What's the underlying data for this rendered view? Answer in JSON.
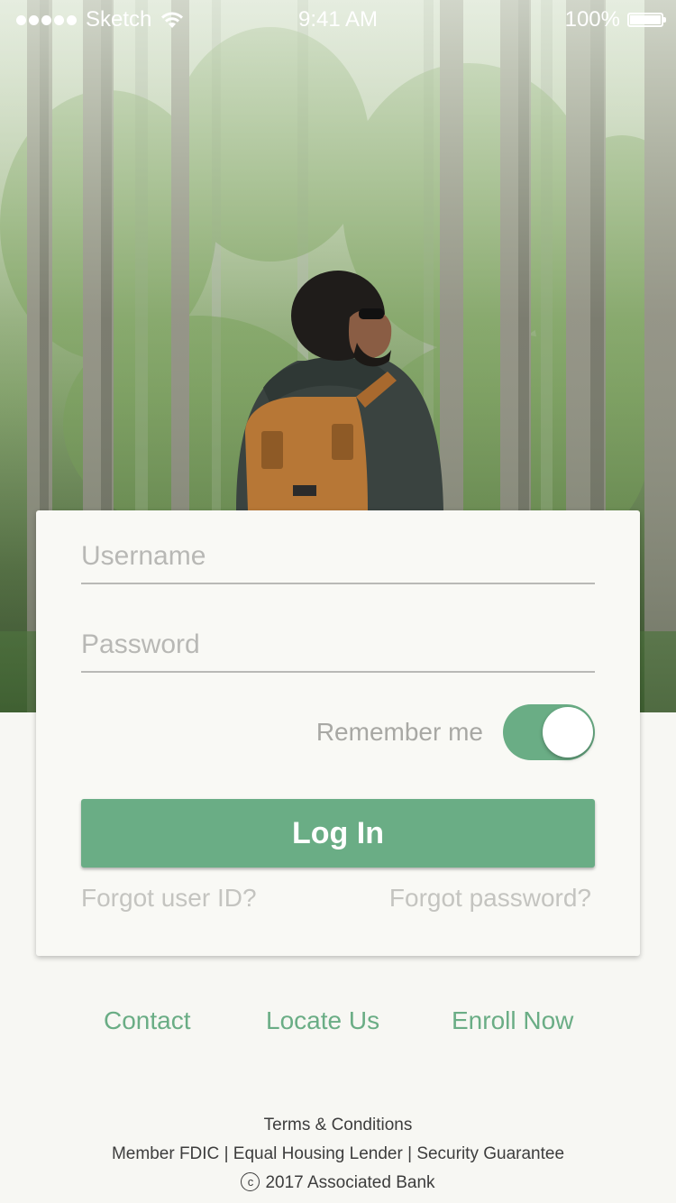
{
  "status_bar": {
    "carrier": "Sketch",
    "time": "9:41 AM",
    "battery_percent": "100%",
    "battery_level": 1.0
  },
  "login": {
    "username_placeholder": "Username",
    "password_placeholder": "Password",
    "remember_label": "Remember me",
    "remember_on": true,
    "login_button": "Log In",
    "forgot_user": "Forgot user ID?",
    "forgot_password": "Forgot password?"
  },
  "nav": {
    "contact": "Contact",
    "locate": "Locate Us",
    "enroll": "Enroll Now"
  },
  "footer": {
    "terms": "Terms & Conditions",
    "member_fdic": "Member FDIC",
    "equal_housing": "Equal Housing Lender",
    "security": "Security Guarantee",
    "separator": "|",
    "copyright_symbol": "c",
    "copyright": "2017 Associated Bank"
  },
  "colors": {
    "accent": "#6aad85",
    "card_bg": "#f9f9f5",
    "page_bg": "#f7f7f3"
  },
  "icons": [
    "signal-dots-icon",
    "wifi-icon",
    "battery-icon",
    "copyright-icon"
  ]
}
